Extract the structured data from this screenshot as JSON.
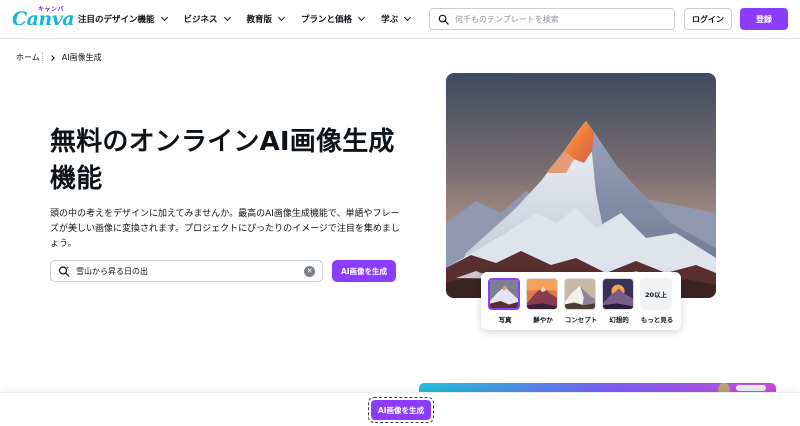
{
  "header": {
    "logo_text": "Canva",
    "logo_kana": "キャンバ",
    "nav": [
      {
        "label": "注目のデザイン機能"
      },
      {
        "label": "ビジネス"
      },
      {
        "label": "教育版"
      },
      {
        "label": "プランと価格"
      },
      {
        "label": "学ぶ"
      }
    ],
    "search_placeholder": "何千ものテンプレートを検索",
    "login_label": "ログイン",
    "signup_label": "登録"
  },
  "breadcrumb": {
    "home": "ホーム",
    "current": "AI画像生成"
  },
  "hero": {
    "title_line1": "無料のオンラインAI画像生成",
    "title_line2": "機能",
    "description": "頭の中の考えをデザインに加えてみませんか。最高のAI画像生成機能で、単語やフレーズが美しい画像に変換されます。プロジェクトにぴったりのイメージで注目を集めましょう。",
    "prompt_value": "雪山から昇る日の出",
    "generate_label": "AI画像を生成"
  },
  "styles": {
    "options": [
      {
        "label": "写真",
        "selected": true
      },
      {
        "label": "鮮やか",
        "selected": false
      },
      {
        "label": "コンセプト",
        "selected": false
      },
      {
        "label": "幻想的",
        "selected": false
      }
    ],
    "more_count": "20以上",
    "more_label": "もっと見る"
  },
  "sticky": {
    "generate_label": "AI画像を生成"
  },
  "colors": {
    "accent": "#8b3dff",
    "logo": "#18b6d6"
  }
}
